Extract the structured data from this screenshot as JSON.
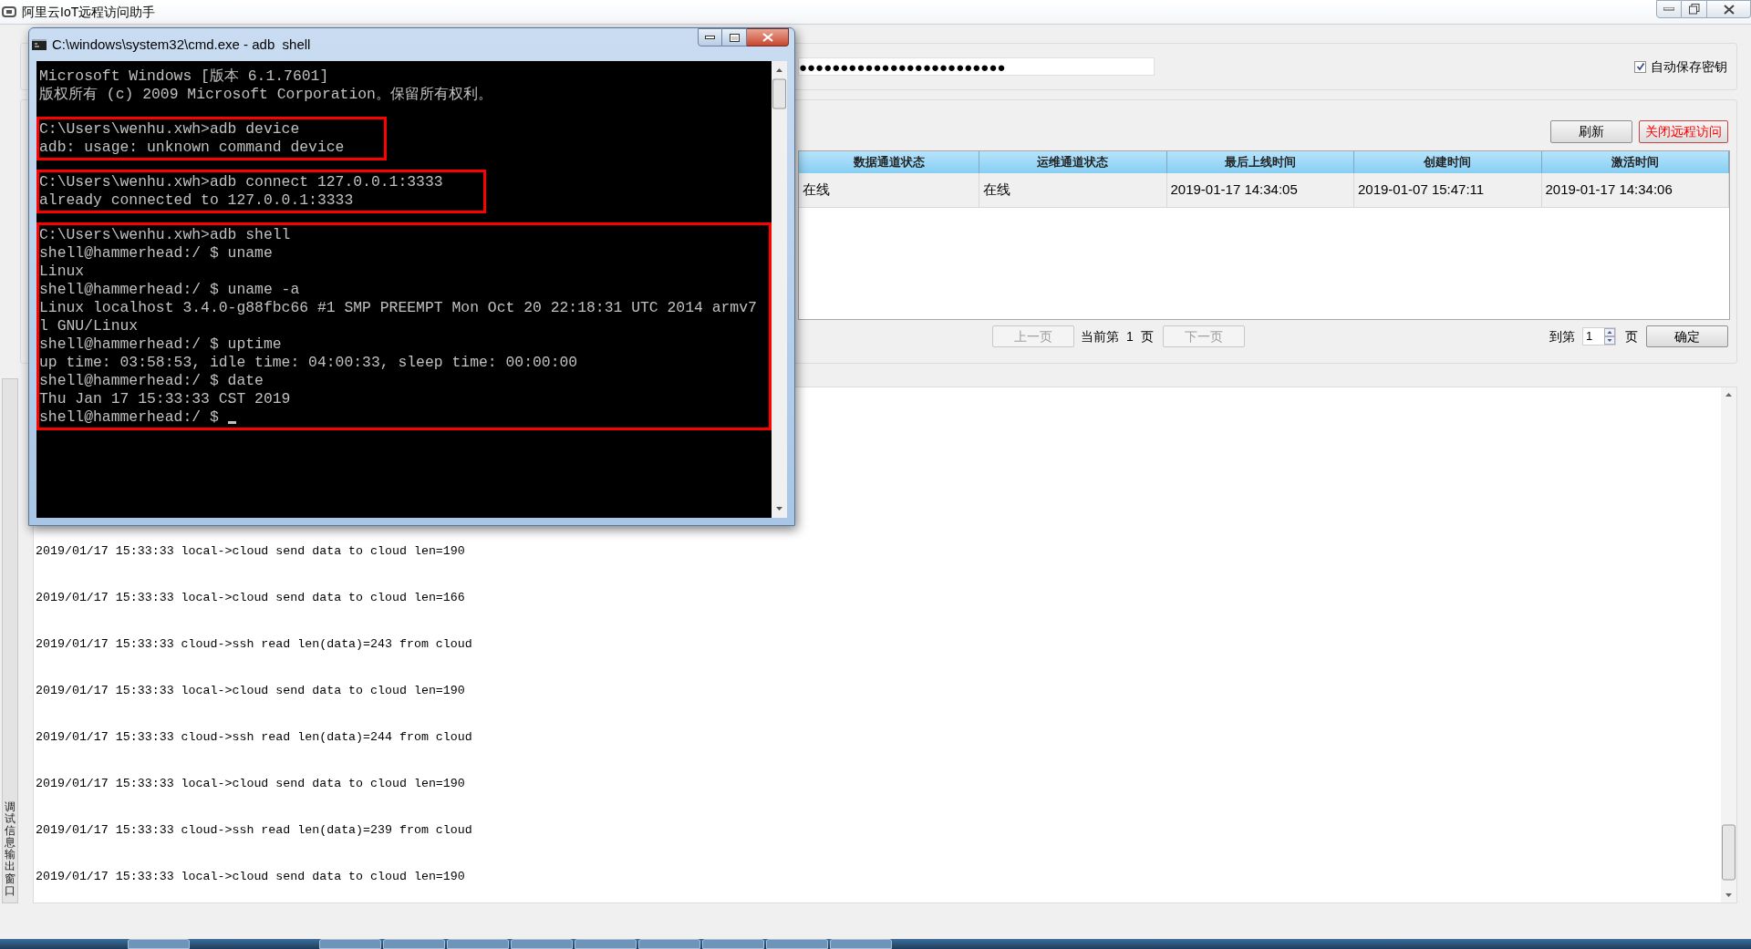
{
  "app": {
    "title": "阿里云IoT远程访问助手"
  },
  "credentials": {
    "secret_value": "●●●●●●●●●●●●●●●●●●●●●●●●●",
    "auto_save": {
      "label": "自动保存密钥",
      "checked": true
    }
  },
  "actions": [
    {
      "label": "刷新",
      "kind": "normal"
    },
    {
      "label": "关闭远程访问",
      "kind": "danger"
    }
  ],
  "table": {
    "columns": [
      "数据通道状态",
      "运维通道状态",
      "最后上线时间",
      "创建时间",
      "激活时间"
    ],
    "rows": [
      {
        "cells": [
          "在线",
          "在线",
          "2019-01-17 14:34:05",
          "2019-01-07 15:47:11",
          "2019-01-17 14:34:06"
        ]
      }
    ]
  },
  "pagination": {
    "prev": {
      "label": "上一页",
      "disabled": true
    },
    "current_label": "当前第",
    "page": "1",
    "page_suffix": "页",
    "next": {
      "label": "下一页",
      "disabled": true
    },
    "goto_label": "到第",
    "goto_value": "1",
    "goto_suffix": "页",
    "confirm": "确定"
  },
  "log_panel": {
    "tab_label": "调试信息输出窗口",
    "lines": [
      "2019/01/17 15:33:33 local->cloud send data to cloud len=190",
      "2019/01/17 15:33:33 local->cloud send data to cloud len=166",
      "2019/01/17 15:33:33 cloud->ssh read len(data)=243 from cloud",
      "2019/01/17 15:33:33 local->cloud send data to cloud len=190",
      "2019/01/17 15:33:33 cloud->ssh read len(data)=244 from cloud",
      "2019/01/17 15:33:33 local->cloud send data to cloud len=190",
      "2019/01/17 15:33:33 cloud->ssh read len(data)=239 from cloud",
      "2019/01/17 15:33:33 local->cloud send data to cloud len=190"
    ]
  },
  "console": {
    "title": "C:\\windows\\system32\\cmd.exe - adb  shell",
    "cursor": true,
    "blocks": [
      {
        "highlighted": false,
        "lines": [
          "Microsoft Windows [版本 6.1.7601]",
          "版权所有 (c) 2009 Microsoft Corporation。保留所有权利。"
        ]
      },
      {
        "highlighted": true,
        "lines": [
          "C:\\Users\\wenhu.xwh>adb device",
          "adb: usage: unknown command device"
        ]
      },
      {
        "highlighted": true,
        "lines": [
          "C:\\Users\\wenhu.xwh>adb connect 127.0.0.1:3333",
          "already connected to 127.0.0.1:3333"
        ]
      },
      {
        "highlighted": true,
        "lines": [
          "C:\\Users\\wenhu.xwh>adb shell",
          "shell@hammerhead:/ $ uname",
          "Linux",
          "shell@hammerhead:/ $ uname -a",
          "Linux localhost 3.4.0-g88fbc66 #1 SMP PREEMPT Mon Oct 20 22:18:31 UTC 2014 armv7",
          "l GNU/Linux",
          "shell@hammerhead:/ $ uptime",
          "up time: 03:58:53, idle time: 04:00:33, sleep time: 00:00:00",
          "shell@hammerhead:/ $ date",
          "Thu Jan 17 15:33:33 CST 2019",
          "shell@hammerhead:/ $ "
        ]
      }
    ]
  }
}
